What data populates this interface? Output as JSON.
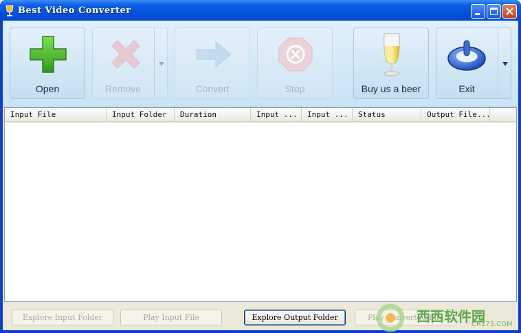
{
  "window": {
    "title": "Best Video Converter"
  },
  "toolbar": {
    "buttons": [
      {
        "label": "Open",
        "icon": "plus-icon",
        "enabled": true
      },
      {
        "label": "Remove",
        "icon": "x-icon",
        "enabled": false,
        "has_dropdown": true
      },
      {
        "label": "Convert",
        "icon": "arrow-right-icon",
        "enabled": false
      },
      {
        "label": "Stop",
        "icon": "stop-icon",
        "enabled": false
      },
      {
        "label": "Buy us a beer",
        "icon": "beer-glass-icon",
        "enabled": true
      },
      {
        "label": "Exit",
        "icon": "power-icon",
        "enabled": true,
        "has_dropdown": true
      }
    ]
  },
  "list": {
    "columns": [
      "Input File",
      "Input Folder",
      "Duration",
      "Input ...",
      "Input ...",
      "Status",
      "Output File..."
    ],
    "rows": []
  },
  "bottom": {
    "buttons": [
      {
        "label": "Explore Input Folder",
        "enabled": false
      },
      {
        "label": "Play Input File",
        "enabled": false
      },
      {
        "label": "Explore Output Folder",
        "enabled": true
      },
      {
        "label": "Play Converted File",
        "enabled": false
      }
    ]
  },
  "watermark": {
    "brand": "西西软件园",
    "site": "CR173.COM"
  },
  "colors": {
    "titlebar": "#0551dd",
    "toolbar_bg": "#d6eaf8",
    "accent_green": "#4cb02e",
    "panel": "#ece9d8"
  }
}
